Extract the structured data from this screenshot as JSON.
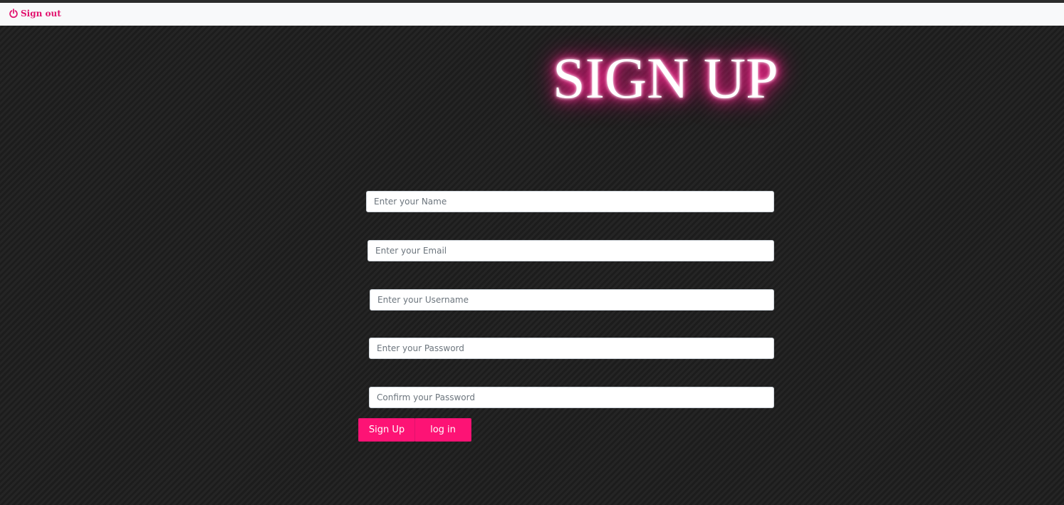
{
  "navbar": {
    "signout": {
      "icon": "power-icon",
      "label": "Sign out"
    }
  },
  "page": {
    "title": "SIGN UP"
  },
  "form": {
    "name_field": {
      "placeholder": "Enter your Name",
      "value": ""
    },
    "email_field": {
      "placeholder": "Enter your Email",
      "value": ""
    },
    "username_field": {
      "placeholder": "Enter your Username",
      "value": ""
    },
    "password_field": {
      "placeholder": "Enter your Password",
      "value": ""
    },
    "confirm_password_field": {
      "placeholder": "Confirm your Password",
      "value": ""
    },
    "signup_label": "Sign Up",
    "login_label": "log in"
  },
  "colors": {
    "accent": "#fd1375",
    "accent_text": "#e2126e",
    "background": "#222222",
    "navbar": "#f8f9fa",
    "glow": "#ff1f8e"
  }
}
